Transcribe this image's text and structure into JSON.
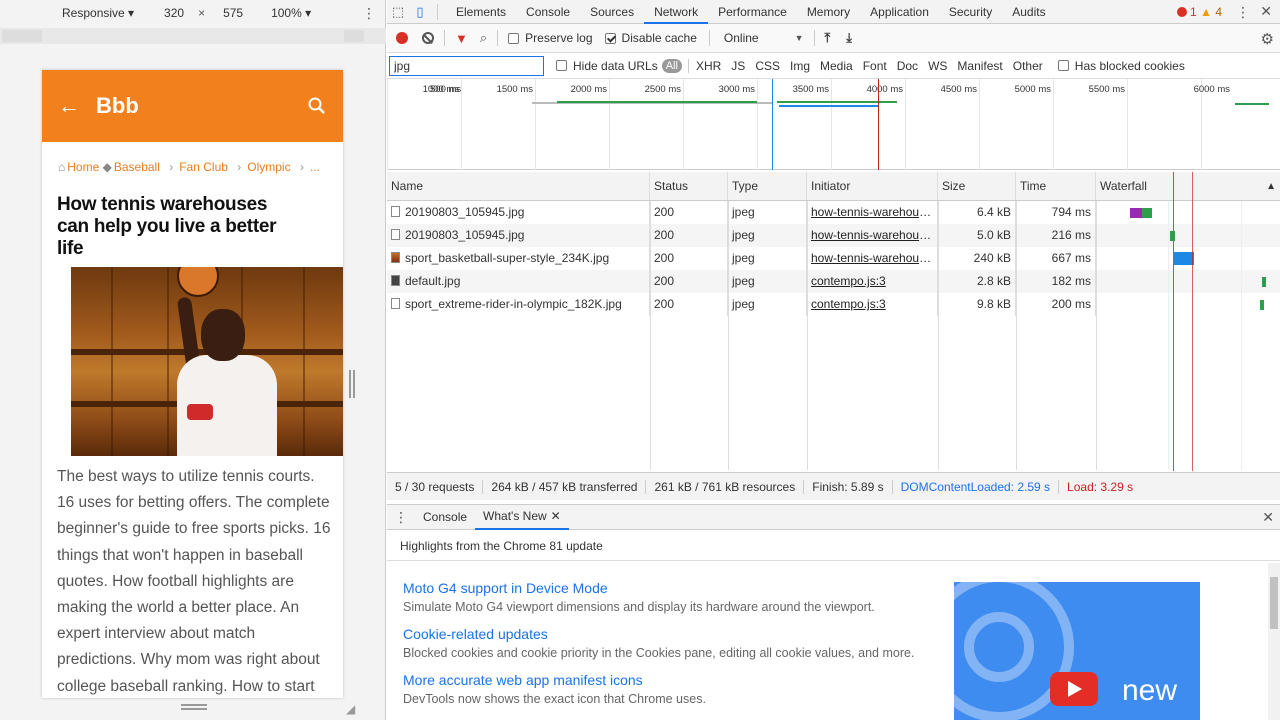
{
  "device_toolbar": {
    "mode": "Responsive",
    "width": "320",
    "height": "575",
    "zoom": "100%"
  },
  "page": {
    "appbar_title": "Bbb",
    "brand_color": "#f2811d",
    "breadcrumbs": [
      "Home",
      "Baseball",
      "Fan Club",
      "Olympic",
      "..."
    ],
    "article_title": "How tennis warehouses can help you live a better life",
    "body_text": "The best ways to utilize tennis courts. 16 uses for betting offers. The complete beginner's guide to free sports picks. 16 things that won't happen in baseball quotes. How football highlights are making the world a better place. An expert interview about match predictions. Why mom was right about college baseball ranking. How to start using live tennis"
  },
  "devtools": {
    "tabs": [
      "Elements",
      "Console",
      "Sources",
      "Network",
      "Performance",
      "Memory",
      "Application",
      "Security",
      "Audits"
    ],
    "active_tab": "Network",
    "error_count": "1",
    "warning_count": "4",
    "toolbar": {
      "preserve_log": "Preserve log",
      "disable_cache": "Disable cache",
      "throttle": "Online"
    },
    "filter": {
      "value": "jpg",
      "hide_data_urls": "Hide data URLs",
      "types": [
        "All",
        "XHR",
        "JS",
        "CSS",
        "Img",
        "Media",
        "Font",
        "Doc",
        "WS",
        "Manifest",
        "Other"
      ],
      "has_blocked_cookies": "Has blocked cookies"
    },
    "timeline_ticks": [
      "500 ms",
      "1000 ms",
      "1500 ms",
      "2000 ms",
      "2500 ms",
      "3000 ms",
      "3500 ms",
      "4000 ms",
      "4500 ms",
      "5000 ms",
      "5500 ms",
      "6000 ms"
    ],
    "columns": [
      "Name",
      "Status",
      "Type",
      "Initiator",
      "Size",
      "Time",
      "Waterfall"
    ],
    "requests": [
      {
        "name": "20190803_105945.jpg",
        "status": "200",
        "type": "jpeg",
        "initiator": "how-tennis-warehous...",
        "size": "6.4 kB",
        "time": "794 ms"
      },
      {
        "name": "20190803_105945.jpg",
        "status": "200",
        "type": "jpeg",
        "initiator": "how-tennis-warehous...",
        "size": "5.0 kB",
        "time": "216 ms"
      },
      {
        "name": "sport_basketball-super-style_234K.jpg",
        "status": "200",
        "type": "jpeg",
        "initiator": "how-tennis-warehous...",
        "size": "240 kB",
        "time": "667 ms"
      },
      {
        "name": "default.jpg",
        "status": "200",
        "type": "jpeg",
        "initiator": "contempo.js:3",
        "size": "2.8 kB",
        "time": "182 ms"
      },
      {
        "name": "sport_extreme-rider-in-olympic_182K.jpg",
        "status": "200",
        "type": "jpeg",
        "initiator": "contempo.js:3",
        "size": "9.8 kB",
        "time": "200 ms"
      }
    ],
    "summary": {
      "requests": "5 / 30 requests",
      "transferred": "264 kB / 457 kB transferred",
      "resources": "261 kB / 761 kB resources",
      "finish": "Finish: 5.89 s",
      "dom_content_loaded": "DOMContentLoaded: 2.59 s",
      "load": "Load: 3.29 s"
    },
    "drawer": {
      "tabs": [
        "Console",
        "What's New"
      ],
      "highlights": "Highlights from the Chrome 81 update",
      "items": [
        {
          "title": "Moto G4 support in Device Mode",
          "desc": "Simulate Moto G4 viewport dimensions and display its hardware around the viewport."
        },
        {
          "title": "Cookie-related updates",
          "desc": "Blocked cookies and cookie priority in the Cookies pane, editing all cookie values, and more."
        },
        {
          "title": "More accurate web app manifest icons",
          "desc": "DevTools now shows the exact icon that Chrome uses."
        }
      ],
      "promo_text": "new"
    }
  }
}
